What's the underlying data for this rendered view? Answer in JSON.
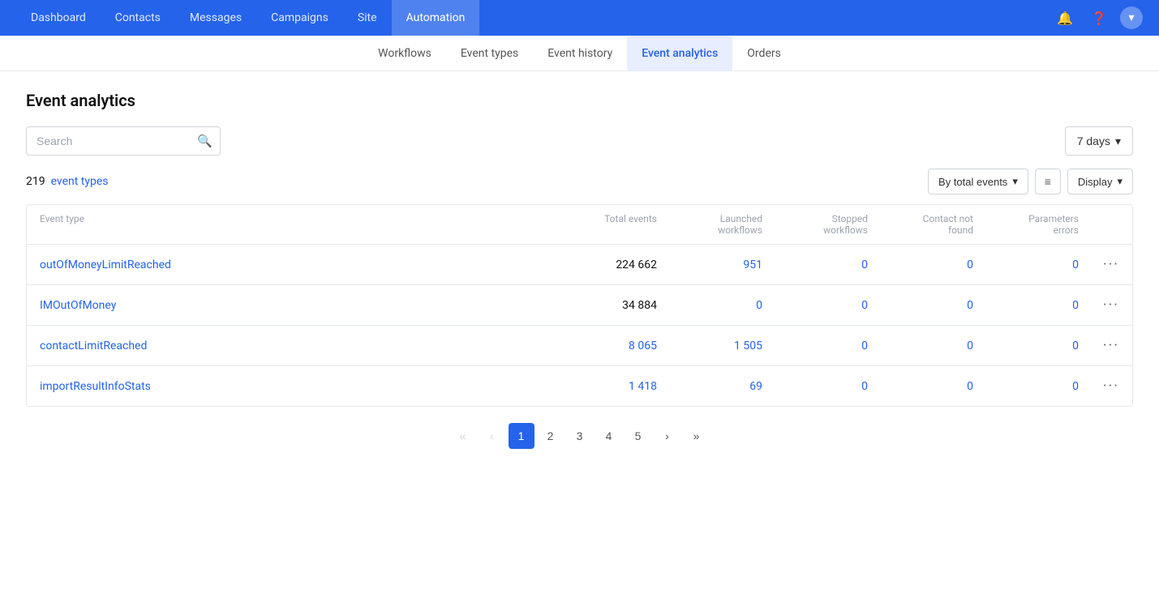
{
  "topNav": {
    "items": [
      {
        "label": "Dashboard",
        "active": false
      },
      {
        "label": "Contacts",
        "active": false
      },
      {
        "label": "Messages",
        "active": false
      },
      {
        "label": "Campaigns",
        "active": false
      },
      {
        "label": "Site",
        "active": false
      },
      {
        "label": "Automation",
        "active": true
      }
    ]
  },
  "subNav": {
    "items": [
      {
        "label": "Workflows",
        "active": false
      },
      {
        "label": "Event types",
        "active": false
      },
      {
        "label": "Event history",
        "active": false
      },
      {
        "label": "Event analytics",
        "active": true
      },
      {
        "label": "Orders",
        "active": false
      }
    ]
  },
  "pageTitle": "Event analytics",
  "search": {
    "placeholder": "Search"
  },
  "daysFilter": {
    "label": "7 days"
  },
  "statsRow": {
    "count": "219",
    "linkLabel": "event types",
    "sortLabel": "By total events",
    "displayLabel": "Display"
  },
  "tableHeaders": {
    "eventType": "Event type",
    "totalEvents": "Total events",
    "launchedWorkflows": "Launched workflows",
    "stoppedWorkflows": "Stopped workflows",
    "contactNotFound": "Contact not found",
    "parametersErrors": "Parameters errors"
  },
  "tableRows": [
    {
      "name": "outOfMoneyLimitReached",
      "totalEvents": "224 662",
      "launchedWorkflows": "951",
      "stoppedWorkflows": "0",
      "contactNotFound": "0",
      "parametersErrors": "0"
    },
    {
      "name": "IMOutOfMoney",
      "totalEvents": "34 884",
      "launchedWorkflows": "0",
      "stoppedWorkflows": "0",
      "contactNotFound": "0",
      "parametersErrors": "0"
    },
    {
      "name": "contactLimitReached",
      "totalEvents": "8 065",
      "launchedWorkflows": "1 505",
      "stoppedWorkflows": "0",
      "contactNotFound": "0",
      "parametersErrors": "0"
    },
    {
      "name": "importResultInfoStats",
      "totalEvents": "1 418",
      "launchedWorkflows": "69",
      "stoppedWorkflows": "0",
      "contactNotFound": "0",
      "parametersErrors": "0"
    }
  ],
  "pagination": {
    "pages": [
      "1",
      "2",
      "3",
      "4",
      "5"
    ],
    "activePage": "1"
  }
}
